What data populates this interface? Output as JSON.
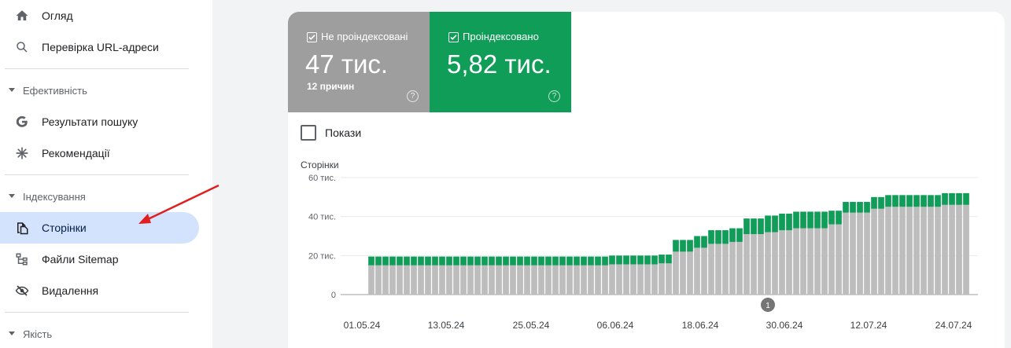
{
  "sidebar": {
    "items_top": [
      {
        "label": "Огляд",
        "icon": "home-icon"
      },
      {
        "label": "Перевірка URL-адреси",
        "icon": "search-icon"
      }
    ],
    "sections": [
      {
        "title": "Ефективність",
        "items": [
          {
            "label": "Результати пошуку",
            "icon": "google-g-icon"
          },
          {
            "label": "Рекомендації",
            "icon": "asterisk-icon"
          }
        ]
      },
      {
        "title": "Індексування",
        "items": [
          {
            "label": "Сторінки",
            "icon": "pages-icon",
            "active": true
          },
          {
            "label": "Файли Sitemap",
            "icon": "sitemap-icon"
          },
          {
            "label": "Видалення",
            "icon": "visibility-off-icon"
          }
        ]
      },
      {
        "title": "Якість",
        "items": []
      }
    ]
  },
  "tiles": {
    "not_indexed": {
      "label": "Не проіндексовані",
      "value": "47 тис.",
      "sub": "12 причин",
      "color": "#9e9e9e"
    },
    "indexed": {
      "label": "Проіндексовано",
      "value": "5,82 тис.",
      "color": "#0f9d58"
    }
  },
  "impressions_label": "Покази",
  "annotation_marker": "1",
  "chart_data": {
    "type": "bar",
    "stacked": true,
    "ylabel": "Сторінки",
    "ylim": [
      0,
      60000
    ],
    "ytick_labels": [
      "60 тис.",
      "40 тис.",
      "20 тис.",
      "0"
    ],
    "xtick_labels": [
      "01.05.24",
      "13.05.24",
      "25.05.24",
      "06.06.24",
      "18.06.24",
      "30.06.24",
      "12.07.24",
      "24.07.24"
    ],
    "series": [
      {
        "name": "Не проіндексовані",
        "color": "#bdbdbd",
        "values": [
          15000,
          15000,
          15000,
          15000,
          15000,
          15000,
          15000,
          15000,
          15000,
          15000,
          15000,
          15000,
          15000,
          15000,
          15000,
          15000,
          15000,
          15000,
          15000,
          15000,
          15000,
          15000,
          15000,
          15000,
          15000,
          15000,
          15000,
          15000,
          15000,
          15000,
          15000,
          15000,
          15000,
          15000,
          15500,
          15500,
          15500,
          15500,
          15500,
          15500,
          15500,
          16000,
          16000,
          22000,
          22000,
          22000,
          24000,
          24000,
          26000,
          26000,
          26000,
          27000,
          27000,
          31000,
          31000,
          31000,
          32000,
          32000,
          33000,
          33000,
          34000,
          34000,
          34000,
          34000,
          34000,
          36000,
          36000,
          42000,
          42000,
          42000,
          42000,
          44000,
          44000,
          45000,
          45000,
          45000,
          45000,
          45000,
          45000,
          45000,
          45000,
          46000,
          46000,
          46000,
          46000
        ]
      },
      {
        "name": "Проіндексовано",
        "color": "#0f9d58",
        "values": [
          4500,
          4500,
          4500,
          4500,
          4500,
          4500,
          4500,
          4500,
          4500,
          4500,
          4500,
          4500,
          4500,
          4500,
          4500,
          4500,
          4500,
          4500,
          4500,
          4500,
          4500,
          4500,
          4500,
          4500,
          4500,
          4500,
          4500,
          4500,
          4500,
          4500,
          4500,
          4500,
          4500,
          4500,
          4500,
          4500,
          4500,
          4500,
          4500,
          4500,
          4500,
          4500,
          4500,
          6000,
          6000,
          6000,
          6000,
          6000,
          7000,
          7000,
          7000,
          7000,
          7000,
          8000,
          8000,
          8000,
          8500,
          8500,
          8500,
          8500,
          8500,
          8500,
          8500,
          8500,
          8500,
          7000,
          7000,
          5500,
          5500,
          5500,
          5500,
          6000,
          6000,
          6000,
          6000,
          6000,
          6000,
          6000,
          6000,
          6000,
          6000,
          6000,
          6000,
          6000,
          6000
        ]
      }
    ]
  }
}
